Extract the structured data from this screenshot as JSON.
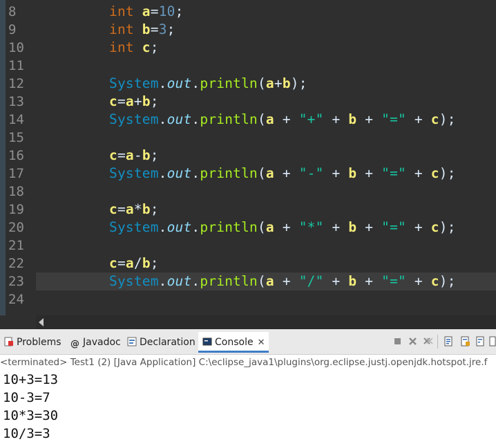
{
  "editor": {
    "lines": [
      {
        "n": "8"
      },
      {
        "n": "9"
      },
      {
        "n": "10"
      },
      {
        "n": "11"
      },
      {
        "n": "12"
      },
      {
        "n": "13"
      },
      {
        "n": "14"
      },
      {
        "n": "15"
      },
      {
        "n": "16"
      },
      {
        "n": "17"
      },
      {
        "n": "18"
      },
      {
        "n": "19"
      },
      {
        "n": "20"
      },
      {
        "n": "21"
      },
      {
        "n": "22"
      },
      {
        "n": "23"
      },
      {
        "n": "24"
      }
    ],
    "current_line": "23",
    "tokens": {
      "int": "int",
      "a": "a",
      "b": "b",
      "c": "c",
      "ten": "10",
      "three": "3",
      "system": "System",
      "out": "out",
      "println": "println",
      "plus_str": "\"+\"",
      "minus_str": "\"-\"",
      "times_str": "\"*\"",
      "div_str": "\"/\"",
      "eq_str": "\"=\""
    }
  },
  "console": {
    "tabs": [
      {
        "label": "Problems",
        "icon": "problems-icon"
      },
      {
        "label": "Javadoc",
        "icon": "javadoc-icon"
      },
      {
        "label": "Declaration",
        "icon": "declaration-icon"
      },
      {
        "label": "Console",
        "icon": "console-icon"
      }
    ],
    "terminated_text": "<terminated> Test1 (2) [Java Application] C:\\eclipse_java1\\plugins\\org.eclipse.justj.openjdk.hotspot.jre.f",
    "output": [
      "10+3=13",
      "10-3=7",
      "10*3=30",
      "10/3=3"
    ]
  },
  "colors": {
    "keyword": "#cc6c1d",
    "variable": "#f3ec79",
    "number": "#6897bb",
    "class": "#1290c3",
    "field": "#8dd9f8",
    "method": "#a7ec21",
    "string": "#17c6a3",
    "active_tab_underline": "#3e7cc8"
  }
}
